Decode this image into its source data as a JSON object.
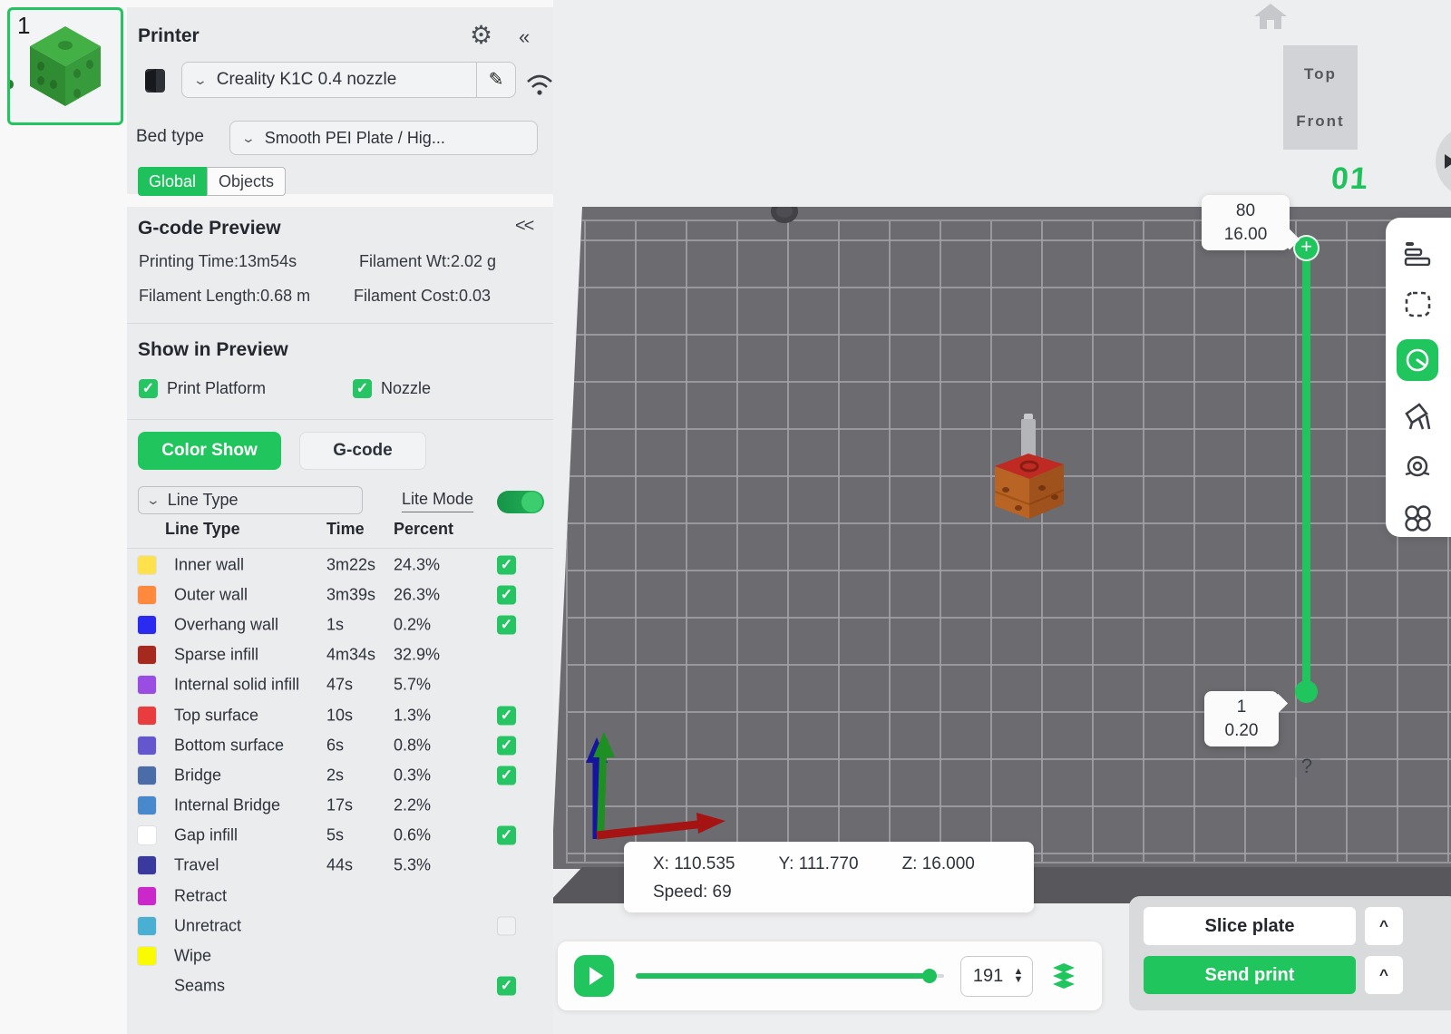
{
  "accent": "#22c55e",
  "icons": {
    "gear": "⚙",
    "collapse_left": "«",
    "collapse_gcode": "<<",
    "chevron_down": "⌄",
    "pencil": "✎",
    "caret_up": "^",
    "help": "?",
    "spin_up": "▲",
    "spin_down": "▼"
  },
  "plate_thumbnail": {
    "number": "1"
  },
  "printer": {
    "title": "Printer",
    "selected": "Creality K1C 0.4 nozzle",
    "bed_type_label": "Bed type",
    "bed_type_value": "Smooth PEI Plate / Hig...",
    "tab_global": "Global",
    "tab_objects": "Objects"
  },
  "gcode": {
    "title": "G-code Preview",
    "stats": [
      "Printing Time:13m54s",
      "Filament Wt:2.02 g",
      "Filament Length:0.68 m",
      "Filament Cost:0.03"
    ],
    "show_in_preview_title": "Show in Preview",
    "preview_items": [
      {
        "label": "Print Platform",
        "check": "checked"
      },
      {
        "label": "Nozzle",
        "check": "checked"
      }
    ],
    "color_show_label": "Color Show",
    "gcode_label": "G-code"
  },
  "line_types": {
    "selector_label": "Line Type",
    "lite_mode_label": "Lite Mode",
    "lite_mode_state": "on",
    "headers": {
      "type": "Line Type",
      "time": "Time",
      "percent": "Percent"
    },
    "rows": [
      {
        "label": "Inner wall",
        "time": "3m22s",
        "percent": "24.3%",
        "color": "#ffe14d",
        "check": "checked"
      },
      {
        "label": "Outer wall",
        "time": "3m39s",
        "percent": "26.3%",
        "color": "#ff8a3e",
        "check": "checked"
      },
      {
        "label": "Overhang wall",
        "time": "1s",
        "percent": "0.2%",
        "color": "#2a2af0",
        "check": "checked"
      },
      {
        "label": "Sparse infill",
        "time": "4m34s",
        "percent": "32.9%",
        "color": "#a5291f",
        "check": "none"
      },
      {
        "label": "Internal solid infill",
        "time": "47s",
        "percent": "5.7%",
        "color": "#9a4de2",
        "check": "none"
      },
      {
        "label": "Top surface",
        "time": "10s",
        "percent": "1.3%",
        "color": "#e83c3e",
        "check": "checked"
      },
      {
        "label": "Bottom surface",
        "time": "6s",
        "percent": "0.8%",
        "color": "#6456cd",
        "check": "checked"
      },
      {
        "label": "Bridge",
        "time": "2s",
        "percent": "0.3%",
        "color": "#4a6ca8",
        "check": "checked"
      },
      {
        "label": "Internal Bridge",
        "time": "17s",
        "percent": "2.2%",
        "color": "#4a88cc",
        "check": "none"
      },
      {
        "label": "Gap infill",
        "time": "5s",
        "percent": "0.6%",
        "color": "#ffffff",
        "check": "checked"
      },
      {
        "label": "Travel",
        "time": "44s",
        "percent": "5.3%",
        "color": "#3a3a9e",
        "check": "none"
      },
      {
        "label": "Retract",
        "time": "",
        "percent": "",
        "color": "#cb28cb",
        "check": "none"
      },
      {
        "label": "Unretract",
        "time": "",
        "percent": "",
        "color": "#49afd3",
        "check": "unchecked"
      },
      {
        "label": "Wipe",
        "time": "",
        "percent": "",
        "color": "#fbfb00",
        "check": "none"
      },
      {
        "label": "Seams",
        "time": "",
        "percent": "",
        "color": null,
        "check": "checked"
      }
    ]
  },
  "viewport": {
    "view_cube": {
      "top": "Top",
      "front": "Front"
    },
    "page_number": "01",
    "layer_slider": {
      "top_layer": "80",
      "top_height": "16.00",
      "bottom_layer": "1",
      "bottom_height": "0.20"
    },
    "help": "?",
    "coords": {
      "x": "X: 110.535",
      "y": "Y: 111.770",
      "z": "Z: 16.000",
      "speed": "Speed: 69"
    }
  },
  "playback": {
    "layer_value": "191"
  },
  "actions": {
    "slice": "Slice plate",
    "send": "Send print",
    "more": "^"
  }
}
